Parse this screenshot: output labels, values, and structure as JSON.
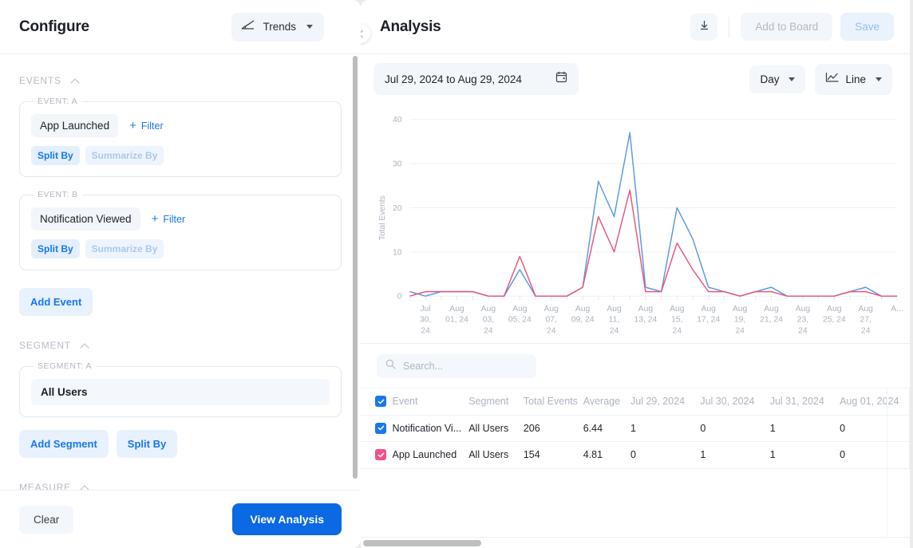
{
  "configure": {
    "title": "Configure",
    "mode_button": {
      "label": "Trends",
      "icon": "trends-chart-icon"
    },
    "sections": {
      "events": {
        "title": "EVENTS"
      },
      "segment": {
        "title": "SEGMENT"
      },
      "measure": {
        "title": "MEASURE"
      }
    },
    "events": [
      {
        "legend": "EVENT: A",
        "name": "App Launched",
        "filter_label": "Filter",
        "split_by_label": "Split By",
        "summarize_by_label": "Summarize By"
      },
      {
        "legend": "EVENT: B",
        "name": "Notification Viewed",
        "filter_label": "Filter",
        "split_by_label": "Split By",
        "summarize_by_label": "Summarize By"
      }
    ],
    "add_event_label": "Add Event",
    "segment": {
      "legend": "SEGMENT: A",
      "value": "All Users",
      "add_segment_label": "Add Segment",
      "split_by_label": "Split By"
    },
    "footer": {
      "clear_label": "Clear",
      "view_analysis_label": "View Analysis"
    }
  },
  "analysis": {
    "title": "Analysis",
    "download_icon": "download-icon",
    "add_to_board_label": "Add to Board",
    "save_label": "Save",
    "toolbar": {
      "date_range": "Jul 29, 2024 to Aug 29, 2024",
      "calendar_icon": "calendar-icon",
      "granularity": "Day",
      "chart_type": "Line",
      "chart_type_icon": "line-chart-icon"
    },
    "search": {
      "placeholder": "Search..."
    }
  },
  "colors": {
    "series_blue": "#5B9BE0",
    "series_pink": "#E8577F",
    "accent_blue": "#1877f2",
    "primary_button": "#0b69e3",
    "checkbox_blue": "#1877f2",
    "checkbox_pink": "#f0518b"
  },
  "chart_data": {
    "type": "line",
    "title": "",
    "xlabel": "",
    "ylabel": "Total Events",
    "ylim": [
      0,
      40
    ],
    "yticks": [
      0,
      10,
      20,
      30,
      40
    ],
    "grid": true,
    "legend": "none",
    "x": [
      "Jul 29, 24",
      "Jul 30, 24",
      "Jul 31, 24",
      "Aug 01, 24",
      "Aug 02, 24",
      "Aug 03, 24",
      "Aug 04, 24",
      "Aug 05, 24",
      "Aug 06, 24",
      "Aug 07, 24",
      "Aug 08, 24",
      "Aug 09, 24",
      "Aug 10, 24",
      "Aug 11, 24",
      "Aug 12, 24",
      "Aug 13, 24",
      "Aug 14, 24",
      "Aug 15, 24",
      "Aug 16, 24",
      "Aug 17, 24",
      "Aug 18, 24",
      "Aug 19, 24",
      "Aug 20, 24",
      "Aug 21, 24",
      "Aug 22, 24",
      "Aug 23, 24",
      "Aug 24, 24",
      "Aug 25, 24",
      "Aug 26, 24",
      "Aug 27, 24",
      "Aug 28, 24",
      "Aug 29, 24"
    ],
    "xtick_labels": [
      "",
      "Jul 30, 24",
      "",
      "Aug 01, 24",
      "",
      "Aug 03, 24",
      "",
      "Aug 05, 24",
      "",
      "Aug 07, 24",
      "",
      "Aug 09, 24",
      "",
      "Aug 11, 24",
      "",
      "Aug 13, 24",
      "",
      "Aug 15, 24",
      "",
      "Aug 17, 24",
      "",
      "Aug 19, 24",
      "",
      "Aug 21, 24",
      "",
      "Aug 23, 24",
      "",
      "Aug 25, 24",
      "",
      "Aug 27, 24",
      "",
      "A..."
    ],
    "series": [
      {
        "name": "Notification Viewed",
        "color": "#5B9BE0",
        "values": [
          1,
          0,
          1,
          1,
          1,
          0,
          0,
          6,
          0,
          0,
          0,
          2,
          26,
          18,
          37,
          2,
          1,
          20,
          13,
          2,
          1,
          0,
          1,
          2,
          0,
          0,
          0,
          0,
          1,
          2,
          0,
          0
        ]
      },
      {
        "name": "App Launched",
        "color": "#E8577F",
        "values": [
          0,
          1,
          1,
          1,
          1,
          0,
          0,
          9,
          0,
          0,
          0,
          2,
          18,
          10,
          24,
          1,
          1,
          12,
          6,
          1,
          1,
          0,
          1,
          1,
          0,
          0,
          0,
          0,
          1,
          1,
          0,
          0
        ]
      }
    ]
  },
  "table": {
    "headers": [
      "Event",
      "Segment",
      "Total Events",
      "Average",
      "Jul 29, 2024",
      "Jul 30, 2024",
      "Jul 31, 2024",
      "Aug 01, 2024"
    ],
    "header_checkbox_checked": true,
    "rows": [
      {
        "checked": true,
        "checkbox_color": "#1877f2",
        "event": "Notification Vi...",
        "segment": "All Users",
        "total_events": "206",
        "average": "6.44",
        "dates": [
          "1",
          "0",
          "1",
          "0"
        ]
      },
      {
        "checked": true,
        "checkbox_color": "#f0518b",
        "event": "App Launched",
        "segment": "All Users",
        "total_events": "154",
        "average": "4.81",
        "dates": [
          "0",
          "1",
          "1",
          "0"
        ]
      }
    ]
  }
}
